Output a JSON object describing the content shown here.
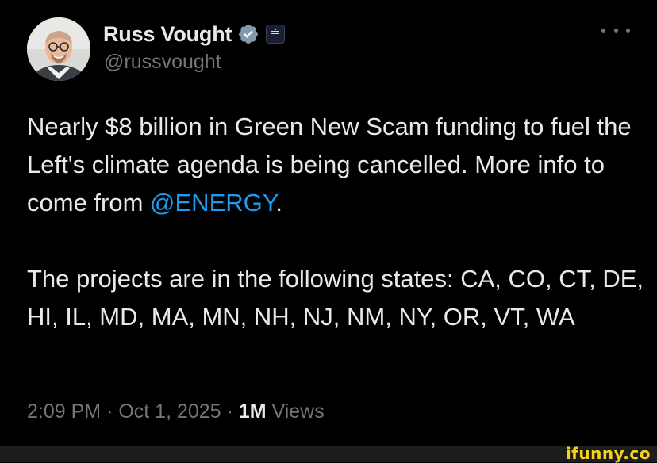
{
  "author": {
    "display_name": "Russ Vought",
    "handle": "@russvought",
    "verified": true,
    "verified_badge_color": "#829aab",
    "affiliation_badge": "white-house-seal-icon"
  },
  "tweet": {
    "paragraph1_text": "Nearly $8 billion in Green New Scam funding to fuel the Left's climate agenda is being cancelled. More info to come from ",
    "mention": "@ENERGY",
    "paragraph1_suffix": ".",
    "paragraph2_text": "The projects are in the following states: CA, CO, CT, DE, HI, IL, MD, MA, MN, NH, NJ, NM, NY, OR, VT, WA"
  },
  "meta": {
    "time": "2:09 PM",
    "separator": " · ",
    "date": "Oct 1, 2025",
    "views_count": "1M",
    "views_label": " Views"
  },
  "more_menu_icon": "more-horizontal-icon",
  "watermark": "ifunny.co",
  "colors": {
    "background": "#000000",
    "text_primary": "#e7e9ea",
    "text_secondary": "#71767b",
    "link": "#1d9bf0",
    "watermark": "#f5d31b"
  }
}
